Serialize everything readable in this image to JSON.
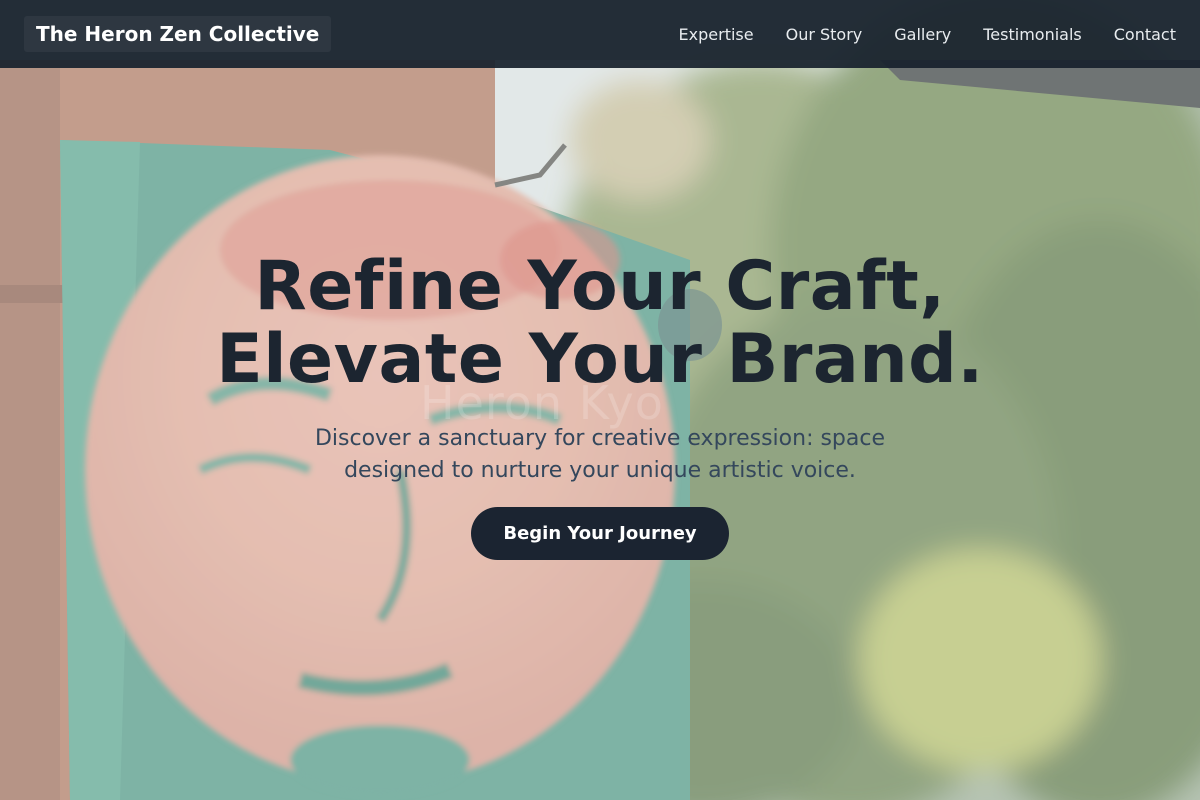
{
  "header": {
    "brand": "The Heron Zen Collective",
    "nav": [
      {
        "label": "Expertise"
      },
      {
        "label": "Our Story"
      },
      {
        "label": "Gallery"
      },
      {
        "label": "Testimonials"
      },
      {
        "label": "Contact"
      }
    ]
  },
  "hero": {
    "title_line1": "Refine Your Craft,",
    "title_line2": "Elevate Your Brand.",
    "subtitle": "Discover a sanctuary for creative expression: space designed to nurture your unique artistic voice.",
    "cta_label": "Begin Your Journey",
    "watermark": "Heron Kyo"
  },
  "colors": {
    "header_bg": "#18212d",
    "title_text": "#1c2530",
    "subtitle_text": "#34475c",
    "cta_bg": "#1b2431",
    "cta_text": "#ffffff"
  }
}
